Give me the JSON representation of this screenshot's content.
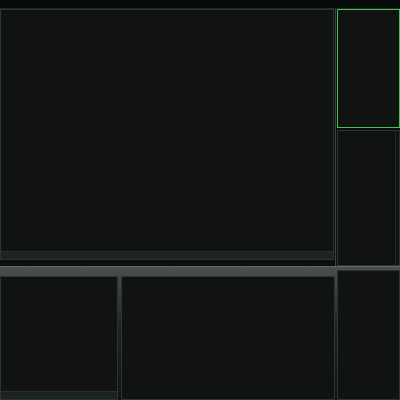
{
  "app": {
    "title": "",
    "workspace": "",
    "clock": ""
  },
  "editor": {
    "lines": [
      "",
      "",
      "",
      "",
      "",
      "",
      "",
      "",
      "",
      "",
      "",
      "",
      "",
      "",
      "",
      "",
      "",
      "",
      "",
      "",
      "",
      "",
      "",
      "",
      "",
      "",
      "",
      "",
      "",
      "",
      "",
      "",
      "",
      ""
    ],
    "modeline": {
      "left": "",
      "mode1": "",
      "mode2": "",
      "right": ""
    }
  },
  "doc_panel": {
    "entries": [
      "",
      "",
      "",
      "",
      "",
      "",
      "",
      "",
      "",
      "",
      "",
      "",
      "",
      "",
      "",
      "",
      "",
      "",
      "",
      "",
      "",
      "",
      "",
      "",
      "",
      "",
      ""
    ],
    "text_lines": [
      "",
      "",
      "",
      "",
      "",
      "",
      "",
      "",
      "",
      "",
      "",
      "",
      "",
      "",
      "",
      "",
      "",
      "",
      "",
      "",
      "",
      "",
      "",
      "",
      "",
      "",
      ""
    ]
  },
  "terminal": {
    "lines": [
      "",
      "",
      "",
      "",
      "",
      "",
      "",
      "",
      "",
      "",
      "",
      "",
      "",
      "",
      "",
      "",
      "",
      "",
      ""
    ],
    "status": ""
  },
  "system": {
    "title": "",
    "rows": [
      "",
      "",
      "",
      ""
    ],
    "metric": "",
    "load": "",
    "uptime": ""
  },
  "tree": {
    "title": "",
    "items": [
      "",
      "",
      "",
      "",
      "",
      "",
      "",
      "",
      "",
      "",
      ""
    ],
    "footer": ""
  },
  "bottom_right": {
    "items": [
      "",
      "",
      "",
      "",
      "",
      "",
      ""
    ]
  }
}
